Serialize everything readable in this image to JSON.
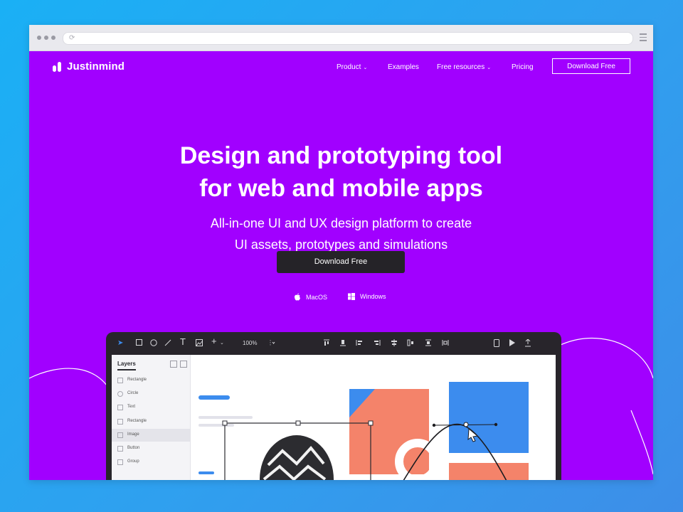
{
  "header": {
    "logo_text": "Justinmind",
    "nav": [
      {
        "label": "Product",
        "caret": true
      },
      {
        "label": "Examples",
        "caret": false
      },
      {
        "label": "Free resources",
        "caret": true
      },
      {
        "label": "Pricing",
        "caret": false
      }
    ],
    "cta_label": "Download Free"
  },
  "hero": {
    "title_line1": "Design and prototyping tool",
    "title_line2": "for web and mobile apps",
    "subtitle_line1": "All-in-one UI and UX design platform to create",
    "subtitle_line2": "UI assets, prototypes and simulations",
    "cta_label": "Download Free",
    "platforms": [
      {
        "label": "MacOS",
        "icon": "apple-icon"
      },
      {
        "label": "Windows",
        "icon": "windows-icon"
      }
    ]
  },
  "app_preview": {
    "zoom": "100%",
    "layers_title": "Layers",
    "layers": [
      {
        "label": "Rectangle",
        "icon": "rectangle-icon",
        "selected": false
      },
      {
        "label": "Circle",
        "icon": "circle-icon",
        "selected": false
      },
      {
        "label": "Text",
        "icon": "text-icon",
        "selected": false
      },
      {
        "label": "Rectangle",
        "icon": "rectangle-icon",
        "selected": false
      },
      {
        "label": "Image",
        "icon": "image-icon",
        "selected": true
      },
      {
        "label": "Button",
        "icon": "button-icon",
        "selected": false
      },
      {
        "label": "Group",
        "icon": "group-icon",
        "selected": false
      }
    ]
  },
  "colors": {
    "page_background": "#1ab0f5",
    "brand_purple": "#a100ff",
    "dark_button": "#252328",
    "accent_blue": "#3c8cee",
    "accent_salmon": "#f4836a"
  }
}
